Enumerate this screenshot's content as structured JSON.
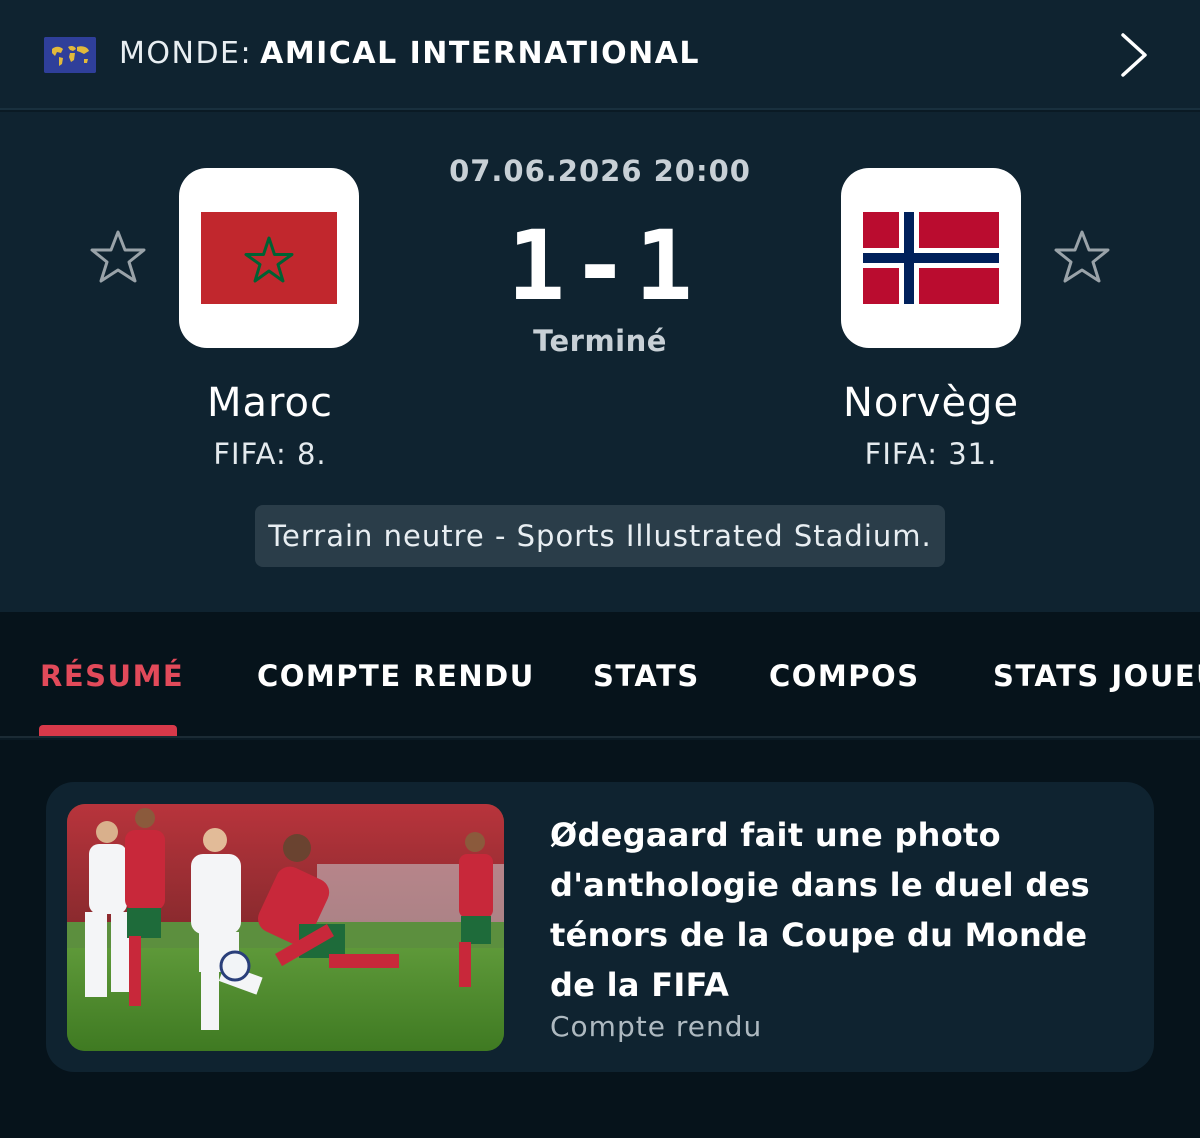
{
  "competition": {
    "country": "MONDE:",
    "name": "AMICAL INTERNATIONAL",
    "icon": "world-map-icon"
  },
  "match": {
    "datetime": "07.06.2026 20:00",
    "score_home": "1",
    "score_separator": "-",
    "score_away": "1",
    "status": "Terminé",
    "venue": "Terrain neutre - Sports Illustrated Stadium."
  },
  "home_team": {
    "name": "Maroc",
    "rank": "FIFA: 8.",
    "flag_colors": {
      "field": "#c1272d",
      "star": "#006233"
    }
  },
  "away_team": {
    "name": "Norvège",
    "rank": "FIFA: 31.",
    "flag_colors": {
      "field": "#ba0c2f",
      "cross_border": "#ffffff",
      "cross": "#00205b"
    }
  },
  "tabs": [
    {
      "label": "RÉSUMÉ",
      "active": true
    },
    {
      "label": "COMPTE RENDU",
      "active": false
    },
    {
      "label": "STATS",
      "active": false
    },
    {
      "label": "COMPOS",
      "active": false
    },
    {
      "label": "STATS JOUEURS",
      "active": false
    }
  ],
  "news": [
    {
      "title": "Ødegaard fait une photo d'anthologie dans le duel des ténors de la Coupe du Monde de la FIFA",
      "category": "Compte rendu"
    }
  ],
  "colors": {
    "background": "#0a1a24",
    "panel": "#0f2330",
    "tabs_background": "#06131b",
    "accent": "#d8394a",
    "venue_pill": "#2a3d49"
  }
}
